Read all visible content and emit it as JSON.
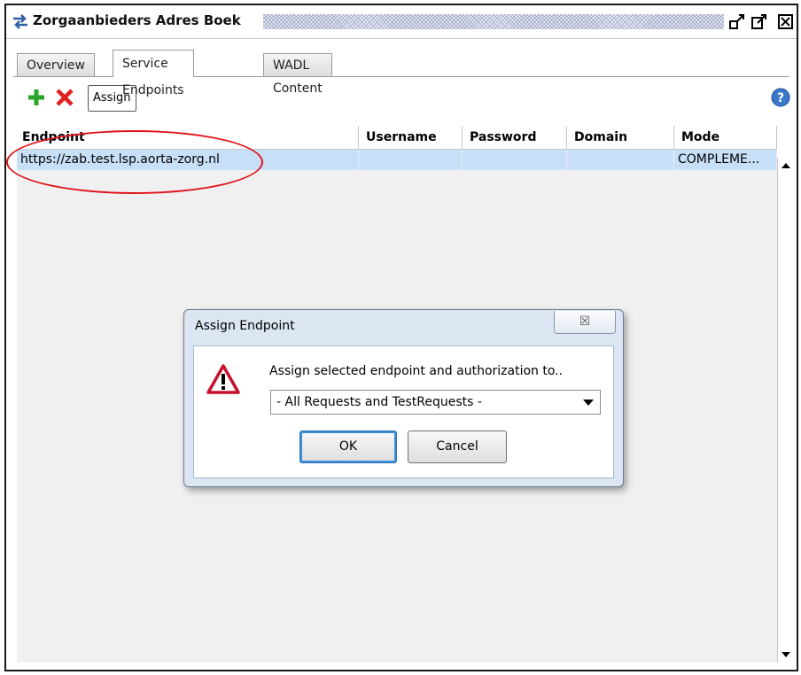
{
  "window": {
    "title": "Zorgaanbieders Adres Boek"
  },
  "tabs": [
    {
      "label": "Overview",
      "active": false
    },
    {
      "label": "Service Endpoints",
      "active": true
    },
    {
      "label": "WADL Content",
      "active": false
    }
  ],
  "toolbar": {
    "add_icon": "plus-icon",
    "delete_icon": "delete-x-icon",
    "assign_label": "Assign",
    "help_icon": "help-icon"
  },
  "table": {
    "columns": [
      "Endpoint",
      "Username",
      "Password",
      "Domain",
      "Mode"
    ],
    "rows": [
      {
        "endpoint": "https://zab.test.lsp.aorta-zorg.nl",
        "username": "",
        "password": "",
        "domain": "",
        "mode": "COMPLEME..."
      }
    ]
  },
  "dialog": {
    "title": "Assign Endpoint",
    "close_glyph": "☒",
    "message": "Assign selected endpoint and authorization to..",
    "selected_option": "- All Requests and TestRequests -",
    "ok_label": "OK",
    "cancel_label": "Cancel"
  },
  "colors": {
    "selection_row": "#c7dff7",
    "annotation": "#e0141a",
    "add": "#2aa52a",
    "delete": "#e02020",
    "help": "#3a78c8"
  }
}
